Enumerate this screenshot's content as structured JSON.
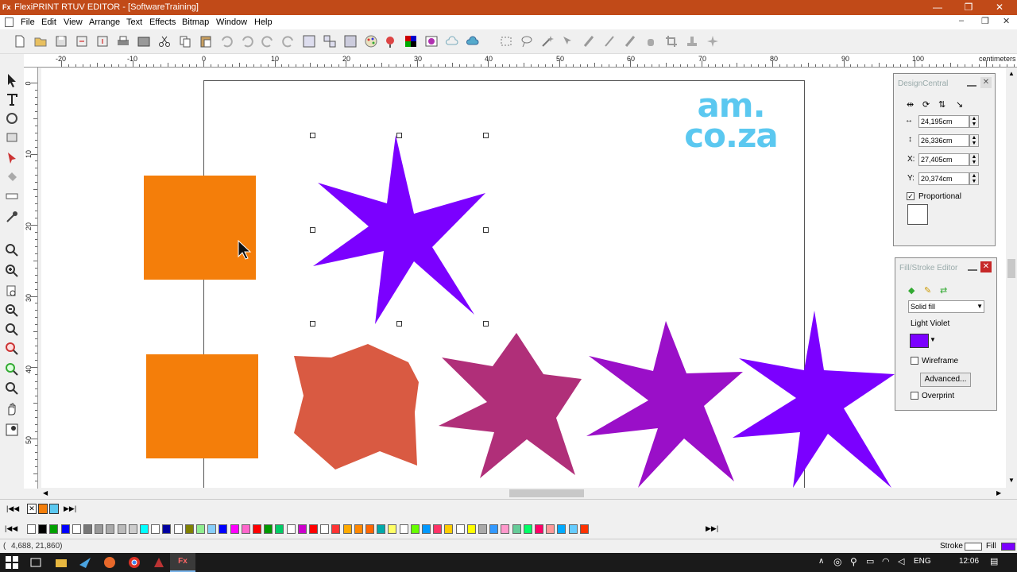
{
  "window": {
    "title": "FlexiPRINT RTUV EDITOR - [SoftwareTraining]",
    "app_icon": "Fx",
    "minimize": "—",
    "maximize": "❐",
    "close": "✕"
  },
  "menu": {
    "items": [
      "File",
      "Edit",
      "View",
      "Arrange",
      "Text",
      "Effects",
      "Bitmap",
      "Window",
      "Help"
    ],
    "mdi_min": "–",
    "mdi_restore": "❐",
    "mdi_close": "✕"
  },
  "ruler": {
    "top_labels": [
      "-20",
      "-10",
      "0",
      "10",
      "20",
      "30",
      "40",
      "50",
      "60",
      "70",
      "80",
      "90",
      "100"
    ],
    "unit": "centimeters",
    "left_labels": [
      "0",
      "10",
      "20",
      "30",
      "40",
      "50"
    ]
  },
  "logo": {
    "line1": "am.",
    "line2": "co.za",
    "color": "#5bc8f0"
  },
  "design_central": {
    "title": "DesignCentral",
    "width": "24,195cm",
    "height": "26,336cm",
    "x_label": "X:",
    "x": "27,405cm",
    "y_label": "Y:",
    "y": "20,374cm",
    "proportional": "Proportional",
    "width_icon": "↔",
    "height_icon": "↕"
  },
  "fill_stroke": {
    "title": "Fill/Stroke Editor",
    "fill_type": "Solid fill",
    "color_name": "Light Violet",
    "color": "#7b00ff",
    "wireframe": "Wireframe",
    "advanced": "Advanced...",
    "overprint": "Overprint"
  },
  "status": {
    "coords": "4,688,   21,860)",
    "stroke": "Stroke",
    "fill": "Fill"
  },
  "taskbar": {
    "lang": "ENG",
    "time": "12:06"
  },
  "colors": {
    "orange": "#f47e0a",
    "violet": "#7b00ff",
    "coral": "#d95a42",
    "magenta": "#b02f79",
    "purple": "#9a0fc8"
  }
}
